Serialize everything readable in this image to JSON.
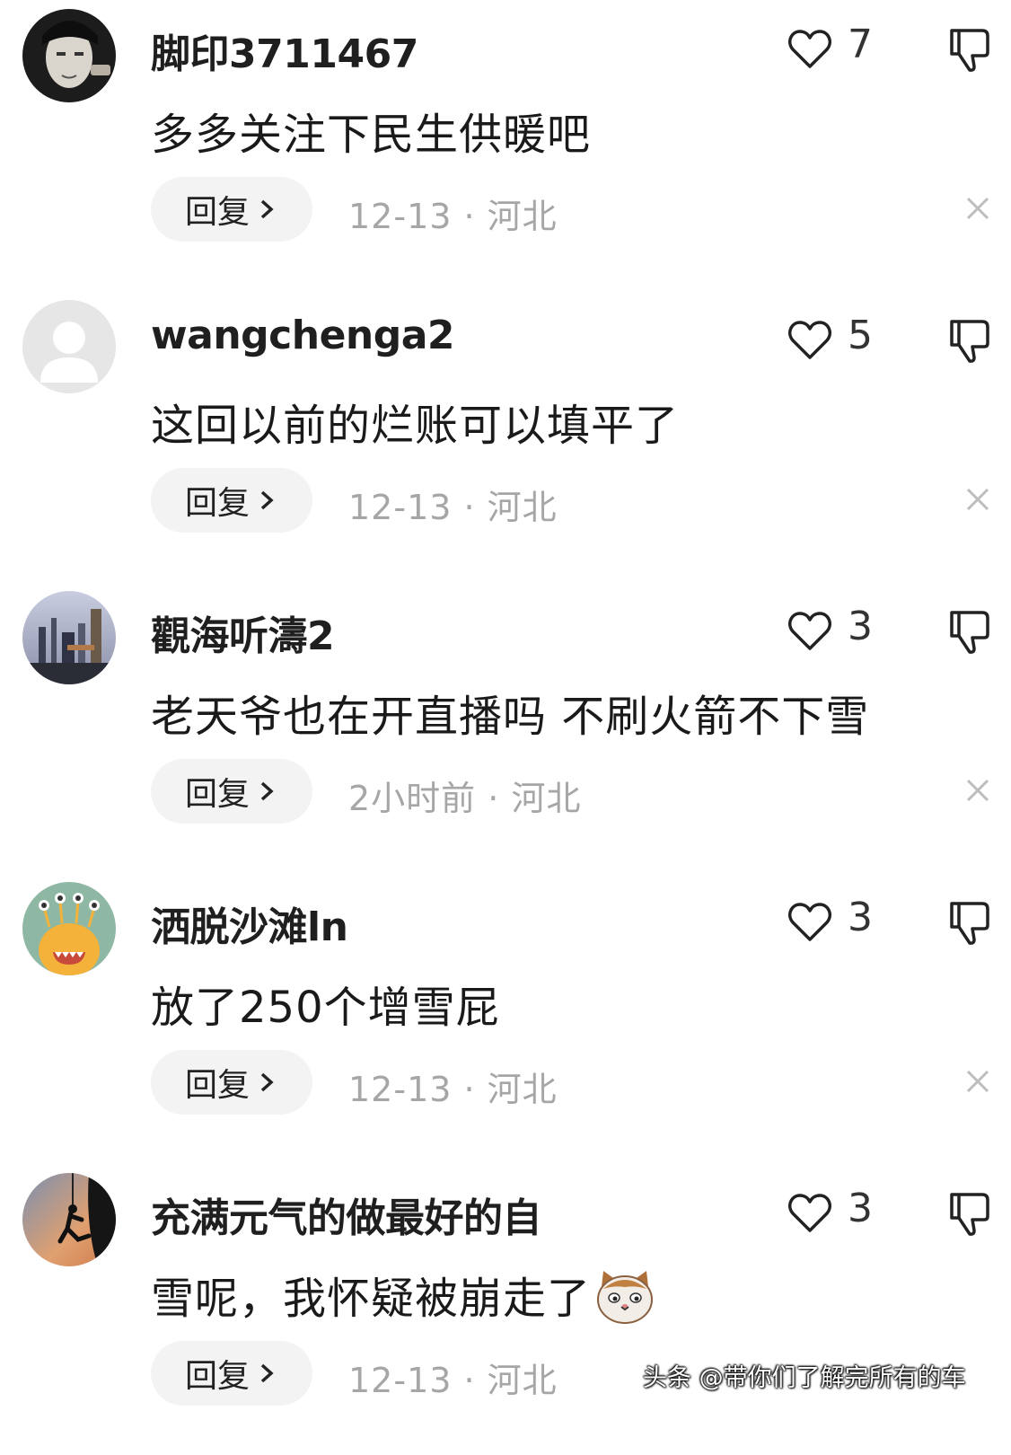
{
  "comments": [
    {
      "username": "脚印3711467",
      "text": "多多关注下民生供暖吧",
      "reply_label": "回复",
      "date": "12-13",
      "location": "河北",
      "likes": "7",
      "avatar": "avatar-portrait"
    },
    {
      "username": "wangchenga2",
      "text": "这回以前的烂账可以填平了",
      "reply_label": "回复",
      "date": "12-13",
      "location": "河北",
      "likes": "5",
      "avatar": "avatar-default"
    },
    {
      "username": "觀海听濤2",
      "text": "老天爷也在开直播吗 不刷火箭不下雪",
      "reply_label": "回复",
      "date": "2小时前",
      "location": "河北",
      "likes": "3",
      "avatar": "avatar-city"
    },
    {
      "username": "洒脱沙滩ln",
      "text": "放了250个增雪屁",
      "reply_label": "回复",
      "date": "12-13",
      "location": "河北",
      "likes": "3",
      "avatar": "avatar-monster"
    },
    {
      "username": "充满元气的做最好的自",
      "text": "雪呢，我怀疑被崩走了",
      "reply_label": "回复",
      "date": "12-13",
      "location": "河北",
      "likes": "3",
      "avatar": "avatar-climber"
    }
  ],
  "meta_separator": " · ",
  "watermark": "头条 @带你们了解完所有的车",
  "colors": {
    "meta_gray": "#a6a6a6",
    "reply_bg": "#f3f3f3",
    "text": "#1a1a1a"
  }
}
